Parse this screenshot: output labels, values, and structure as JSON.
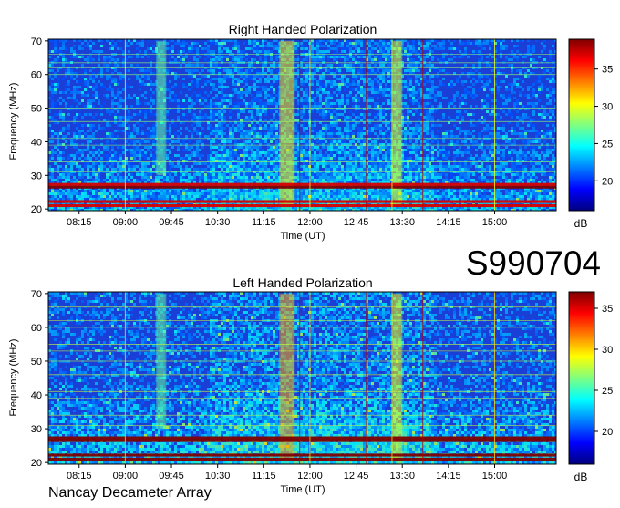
{
  "station": "Nancay Decameter Array",
  "observation_id": "S990704",
  "colors": {
    "colormap": [
      "#00007f",
      "#0000ff",
      "#007fff",
      "#00ffff",
      "#7fff7f",
      "#ffff00",
      "#ff7f00",
      "#ff0000",
      "#7f0000"
    ],
    "background": "#1a3fd6",
    "rfi_line": "#b00000"
  },
  "chart_data": [
    {
      "type": "heatmap",
      "title": "Right Handed Polarization",
      "xlabel": "Time (UT)",
      "ylabel": "Frequency (MHz)",
      "x_ticks": [
        "08:15",
        "09:00",
        "09:45",
        "10:30",
        "11:15",
        "12:00",
        "12:45",
        "13:30",
        "14:15",
        "15:00"
      ],
      "x_tick_minutes": [
        495,
        540,
        585,
        630,
        675,
        720,
        765,
        810,
        855,
        900
      ],
      "xlim_minutes": [
        465,
        960
      ],
      "y_ticks": [
        20,
        30,
        40,
        50,
        60,
        70
      ],
      "ylim": [
        19.5,
        70.5
      ],
      "colorbar": {
        "label": "dB",
        "ticks": [
          20,
          25,
          30,
          35
        ],
        "range": [
          16,
          39
        ]
      },
      "features": {
        "strong_bands_mhz": [
          21.0,
          22.2,
          26.5,
          27.3
        ],
        "horizontal_rfi_mhz": [
          31,
          34,
          39,
          41,
          46,
          50,
          53,
          60,
          62,
          63.5,
          66
        ],
        "emission_bursts": [
          {
            "start": "11:30",
            "end": "11:45",
            "fmin": 21,
            "fmax": 70,
            "db": 31
          },
          {
            "start": "13:20",
            "end": "13:30",
            "fmin": 21,
            "fmax": 70,
            "db": 30
          },
          {
            "start": "09:30",
            "end": "09:40",
            "fmin": 30,
            "fmax": 70,
            "db": 27
          }
        ],
        "vertical_lines": [
          "09:00",
          "11:50",
          "12:00",
          "12:55",
          "13:20",
          "13:50",
          "15:00"
        ]
      }
    },
    {
      "type": "heatmap",
      "title": "Left Handed Polarization",
      "xlabel": "Time (UT)",
      "ylabel": "Frequency (MHz)",
      "x_ticks": [
        "08:15",
        "09:00",
        "09:45",
        "10:30",
        "11:15",
        "12:00",
        "12:45",
        "13:30",
        "14:15",
        "15:00"
      ],
      "x_tick_minutes": [
        495,
        540,
        585,
        630,
        675,
        720,
        765,
        810,
        855,
        900
      ],
      "xlim_minutes": [
        465,
        960
      ],
      "y_ticks": [
        20,
        30,
        40,
        50,
        60,
        70
      ],
      "ylim": [
        19.5,
        70.5
      ],
      "colorbar": {
        "label": "dB",
        "ticks": [
          20,
          25,
          30,
          35
        ],
        "range": [
          16,
          37
        ]
      },
      "features": {
        "strong_bands_mhz": [
          21.0,
          22.2,
          26.5,
          27.3
        ],
        "horizontal_rfi_mhz": [
          31,
          34,
          39,
          41,
          46,
          50,
          53,
          55,
          60,
          62,
          66
        ],
        "emission_bursts": [
          {
            "start": "11:30",
            "end": "11:45",
            "fmin": 21,
            "fmax": 70,
            "db": 31
          },
          {
            "start": "13:20",
            "end": "13:30",
            "fmin": 21,
            "fmax": 70,
            "db": 29
          },
          {
            "start": "09:30",
            "end": "09:40",
            "fmin": 30,
            "fmax": 70,
            "db": 26
          }
        ],
        "vertical_lines": [
          "09:00",
          "11:50",
          "12:00",
          "12:55",
          "13:20",
          "13:50",
          "15:00"
        ]
      }
    }
  ]
}
